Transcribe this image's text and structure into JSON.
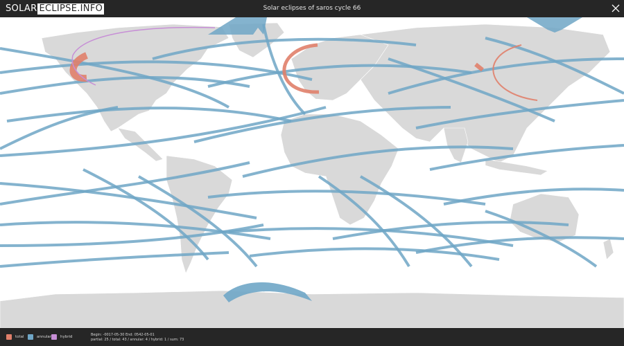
{
  "header": {
    "logo_part1": "SOLAR",
    "logo_part2": "ECLIPSE.INFO",
    "title": "Solar eclipses of saros cycle 66"
  },
  "colors": {
    "bar": "#262626",
    "land": "#d9d9d9",
    "border": "#ffffff",
    "total": "#e07f6a",
    "annular": "#6fa6c6",
    "hybrid": "#c78fd6"
  },
  "legend": [
    {
      "label": "total",
      "type": "total"
    },
    {
      "label": "annular",
      "type": "annular"
    },
    {
      "label": "hybrid",
      "type": "hybrid"
    }
  ],
  "footer": {
    "range": "Begin: -0017-05-30 End: 0542-05-01",
    "counts": "partial: 25 / total: 43 / annular: 4 / hybrid: 1 / sum: 73"
  },
  "map": {
    "projection": "equirectangular world map"
  }
}
